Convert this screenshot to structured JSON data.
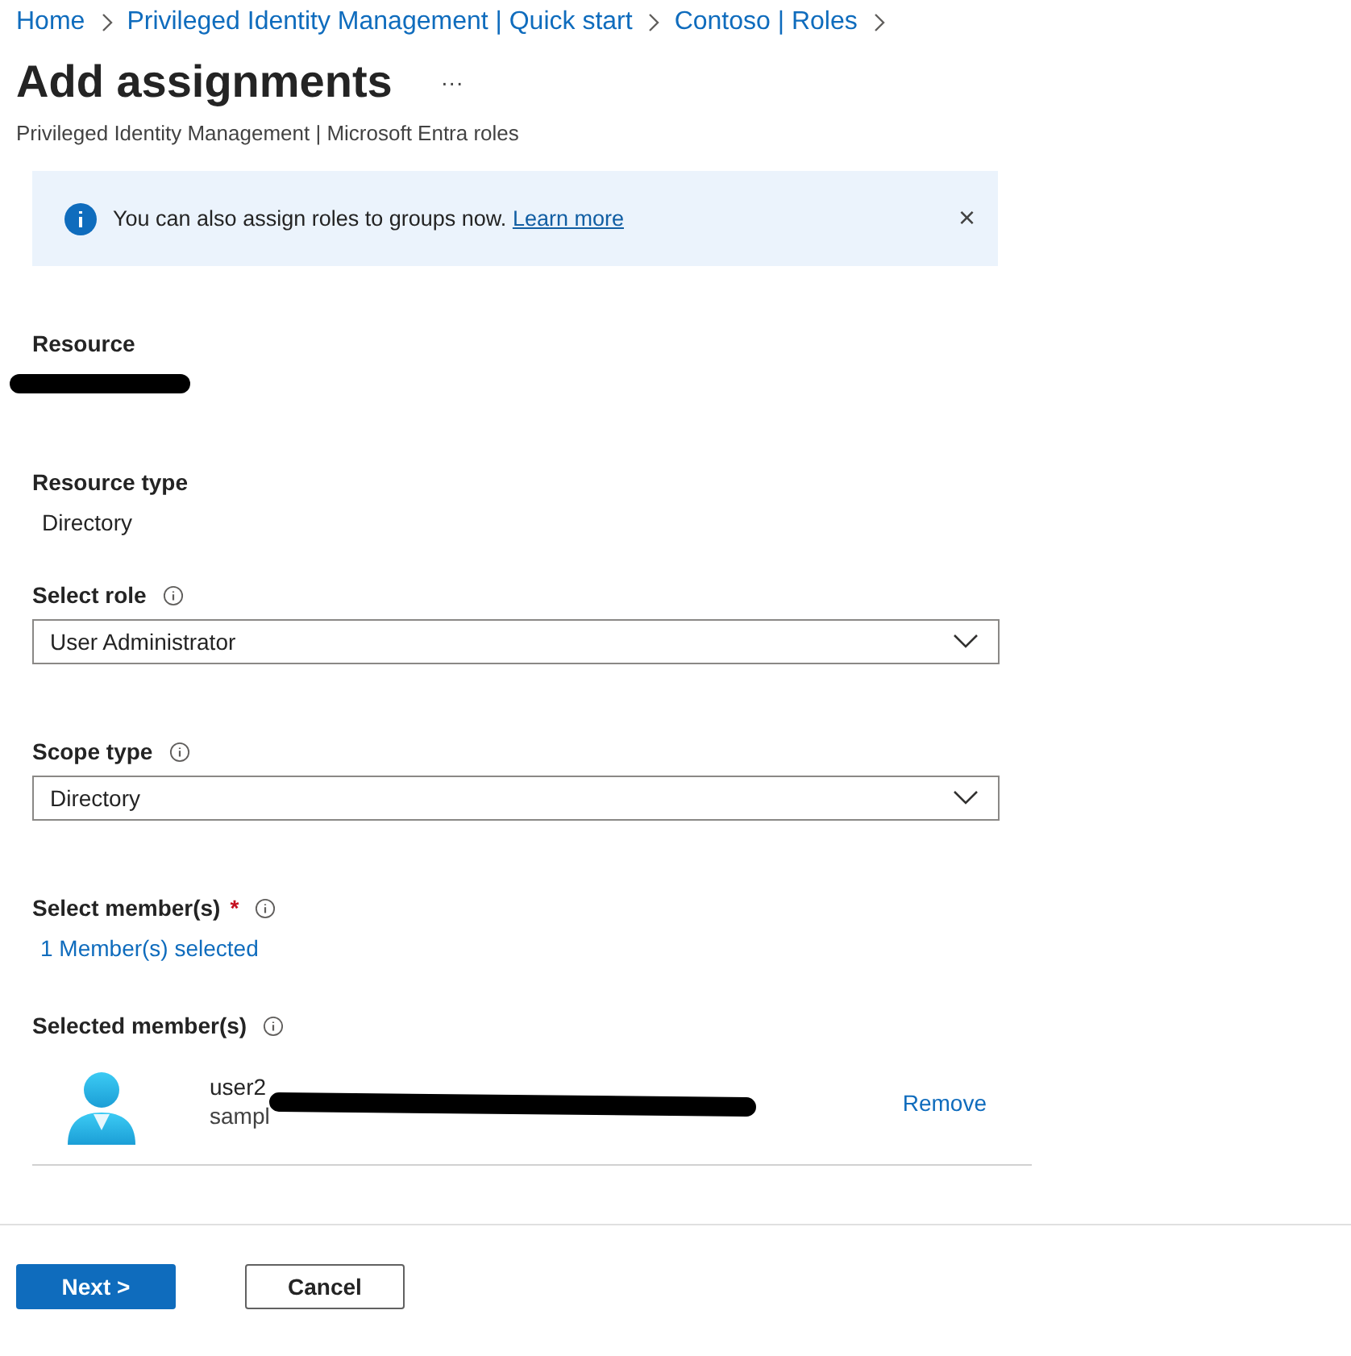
{
  "breadcrumb": [
    "Home",
    "Privileged Identity Management | Quick start",
    "Contoso | Roles"
  ],
  "title": "Add assignments",
  "more": "···",
  "subtitle": "Privileged Identity Management | Microsoft Entra roles",
  "banner": {
    "text": "You can also assign roles to groups now.",
    "link": "Learn more",
    "close": "×"
  },
  "fields": [
    {
      "kind": "redacted",
      "label": "Resource",
      "info": false
    },
    {
      "kind": "static",
      "label": "Resource type",
      "value": "Directory",
      "info": false
    },
    {
      "kind": "dropdown",
      "label": "Select role",
      "value": "User Administrator",
      "info": true
    },
    {
      "kind": "dropdown",
      "label": "Scope type",
      "value": "Directory",
      "info": true
    },
    {
      "kind": "link",
      "label": "Select member(s)",
      "value": "1 Member(s) selected",
      "info": true,
      "required_mark": "*"
    }
  ],
  "members_label": "Selected member(s)",
  "members": [
    {
      "name": "user2",
      "email": "sampl",
      "action": "Remove"
    }
  ],
  "buttons": [
    {
      "label": "Next >",
      "kind": "primary"
    },
    {
      "label": "Cancel",
      "kind": "secondary"
    }
  ]
}
